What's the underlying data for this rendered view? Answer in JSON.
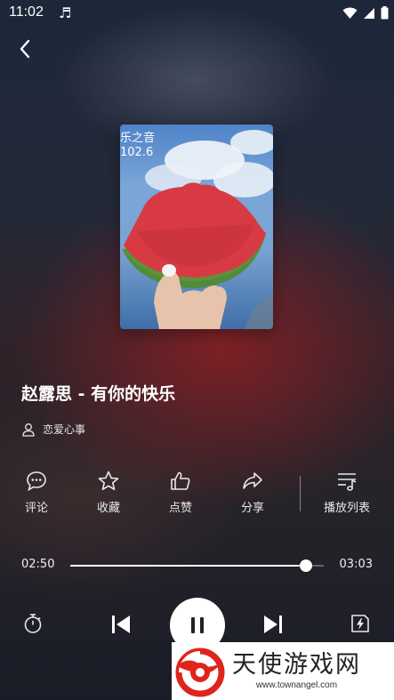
{
  "status_bar": {
    "time": "11:02",
    "notification_icon": "music-note-icon",
    "icons": [
      "wifi-icon",
      "signal-icon",
      "battery-icon"
    ]
  },
  "nav": {
    "back_icon": "chevron-left-icon"
  },
  "cover": {
    "logo_line1": "乐之音",
    "logo_line2": "102.6",
    "image": "watermelon-slice-photo"
  },
  "song": {
    "title": "赵露思 - 有你的快乐",
    "artist": "恋爱心事",
    "artist_icon": "user-icon"
  },
  "actions": [
    {
      "label": "评论",
      "icon": "comment-icon"
    },
    {
      "label": "收藏",
      "icon": "star-icon"
    },
    {
      "label": "点赞",
      "icon": "thumbs-up-icon"
    },
    {
      "label": "分享",
      "icon": "share-icon"
    },
    {
      "label": "播放列表",
      "icon": "playlist-icon"
    }
  ],
  "progress": {
    "current": "02:50",
    "total": "03:03",
    "fraction": 0.93
  },
  "controls": {
    "timer_icon": "timer-icon",
    "prev_icon": "skip-previous-icon",
    "play_state_icon": "pause-icon",
    "next_icon": "skip-next-icon",
    "speed_icon": "flash-icon"
  },
  "watermark": {
    "brand": "天使游戏网",
    "url": "www.townangel.com"
  },
  "colors": {
    "accent": "#ffffff",
    "watermark_red": "#e0241b"
  }
}
